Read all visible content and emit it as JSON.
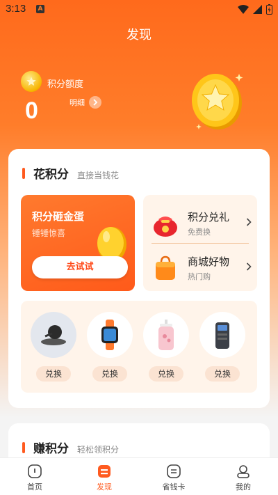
{
  "status_bar": {
    "time": "3:13",
    "notification_badge": "A"
  },
  "header": {
    "title": "发现"
  },
  "points": {
    "label": "积分额度",
    "value": "0",
    "detail_link": "明细"
  },
  "spend_section": {
    "title": "花积分",
    "subtitle": "直接当钱花",
    "egg_game": {
      "title": "积分砸金蛋",
      "subtitle": "锤锤惊喜",
      "button": "去试试"
    },
    "links": [
      {
        "title": "积分兑礼",
        "subtitle": "免费换",
        "icon": "red-gift-bag-icon"
      },
      {
        "title": "商城好物",
        "subtitle": "热门购",
        "icon": "shopping-bag-icon"
      }
    ],
    "products": [
      {
        "name": "wireless-charger",
        "button": "兑换"
      },
      {
        "name": "smart-watch",
        "button": "兑换"
      },
      {
        "name": "body-wash-bottle",
        "button": "兑换"
      },
      {
        "name": "gaming-power-bank",
        "button": "兑换"
      }
    ]
  },
  "earn_section": {
    "title": "赚积分",
    "subtitle": "轻松领积分"
  },
  "tabbar": {
    "active": "发现",
    "items": [
      {
        "label": "首页",
        "icon": "home-icon"
      },
      {
        "label": "发现",
        "icon": "discover-icon"
      },
      {
        "label": "省钱卡",
        "icon": "card-icon"
      },
      {
        "label": "我的",
        "icon": "profile-icon"
      }
    ]
  },
  "colors": {
    "accent": "#ff5a1f",
    "hero_top": "#ff6a1c",
    "panel_bg": "#fff4ea",
    "coin": "#f7b500"
  }
}
